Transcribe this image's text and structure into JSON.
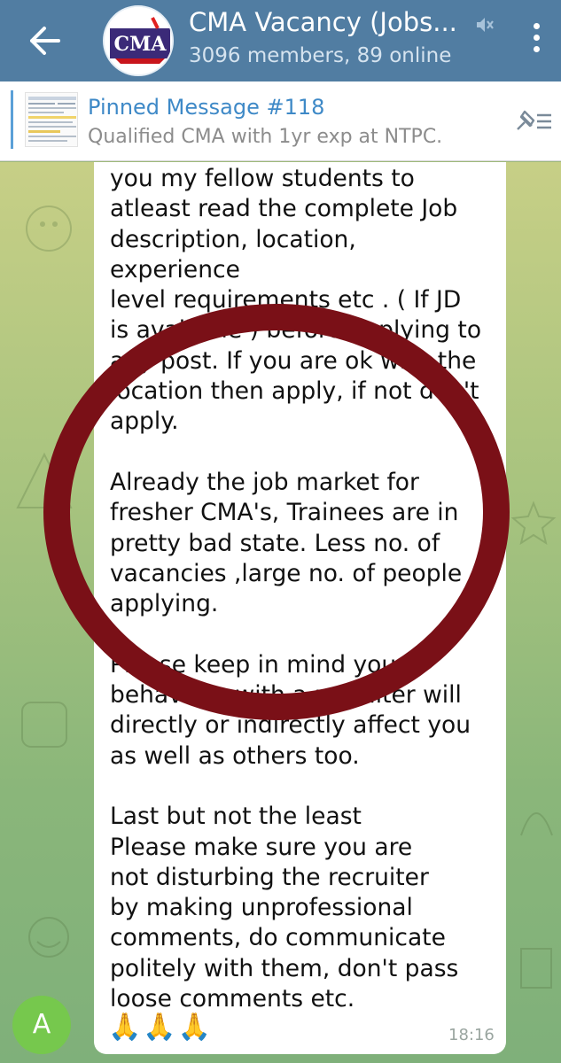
{
  "header": {
    "title": "CMA Vacancy (Jobs...",
    "subtitle": "3096 members, 89 online",
    "avatar_text": "CMA"
  },
  "pinned": {
    "title": "Pinned Message #118",
    "preview": "Qualified CMA with 1yr exp at NTPC."
  },
  "message": {
    "text": "you my fellow students to\natleast read the complete Job\ndescription, location, experience\nlevel requirements etc . ( If JD\nis available ) before applying to\nany post. If you are ok with the\nlocation then apply, if not don't\napply.\n\nAlready the job market for\nfresher CMA's, Trainees are in\npretty bad state. Less no. of\nvacancies ,large no. of people\napplying.\n\nPlease keep in mind your\nbehaviour with a recruiter will\ndirectly or indirectly affect you\nas well as others too.\n\nLast but not the least\nPlease make sure you are\nnot disturbing the recruiter\nby making unprofessional\ncomments, do communicate\npolitely with them, don't pass\nloose comments etc.",
    "emoji": "🙏🙏🙏",
    "time": "18:16"
  },
  "sender": {
    "initial": "A"
  },
  "colors": {
    "header_bg": "#517da2",
    "pinned_title": "#3e89c7",
    "circle": "#7a1017",
    "avatar_bg": "#76c84d"
  }
}
